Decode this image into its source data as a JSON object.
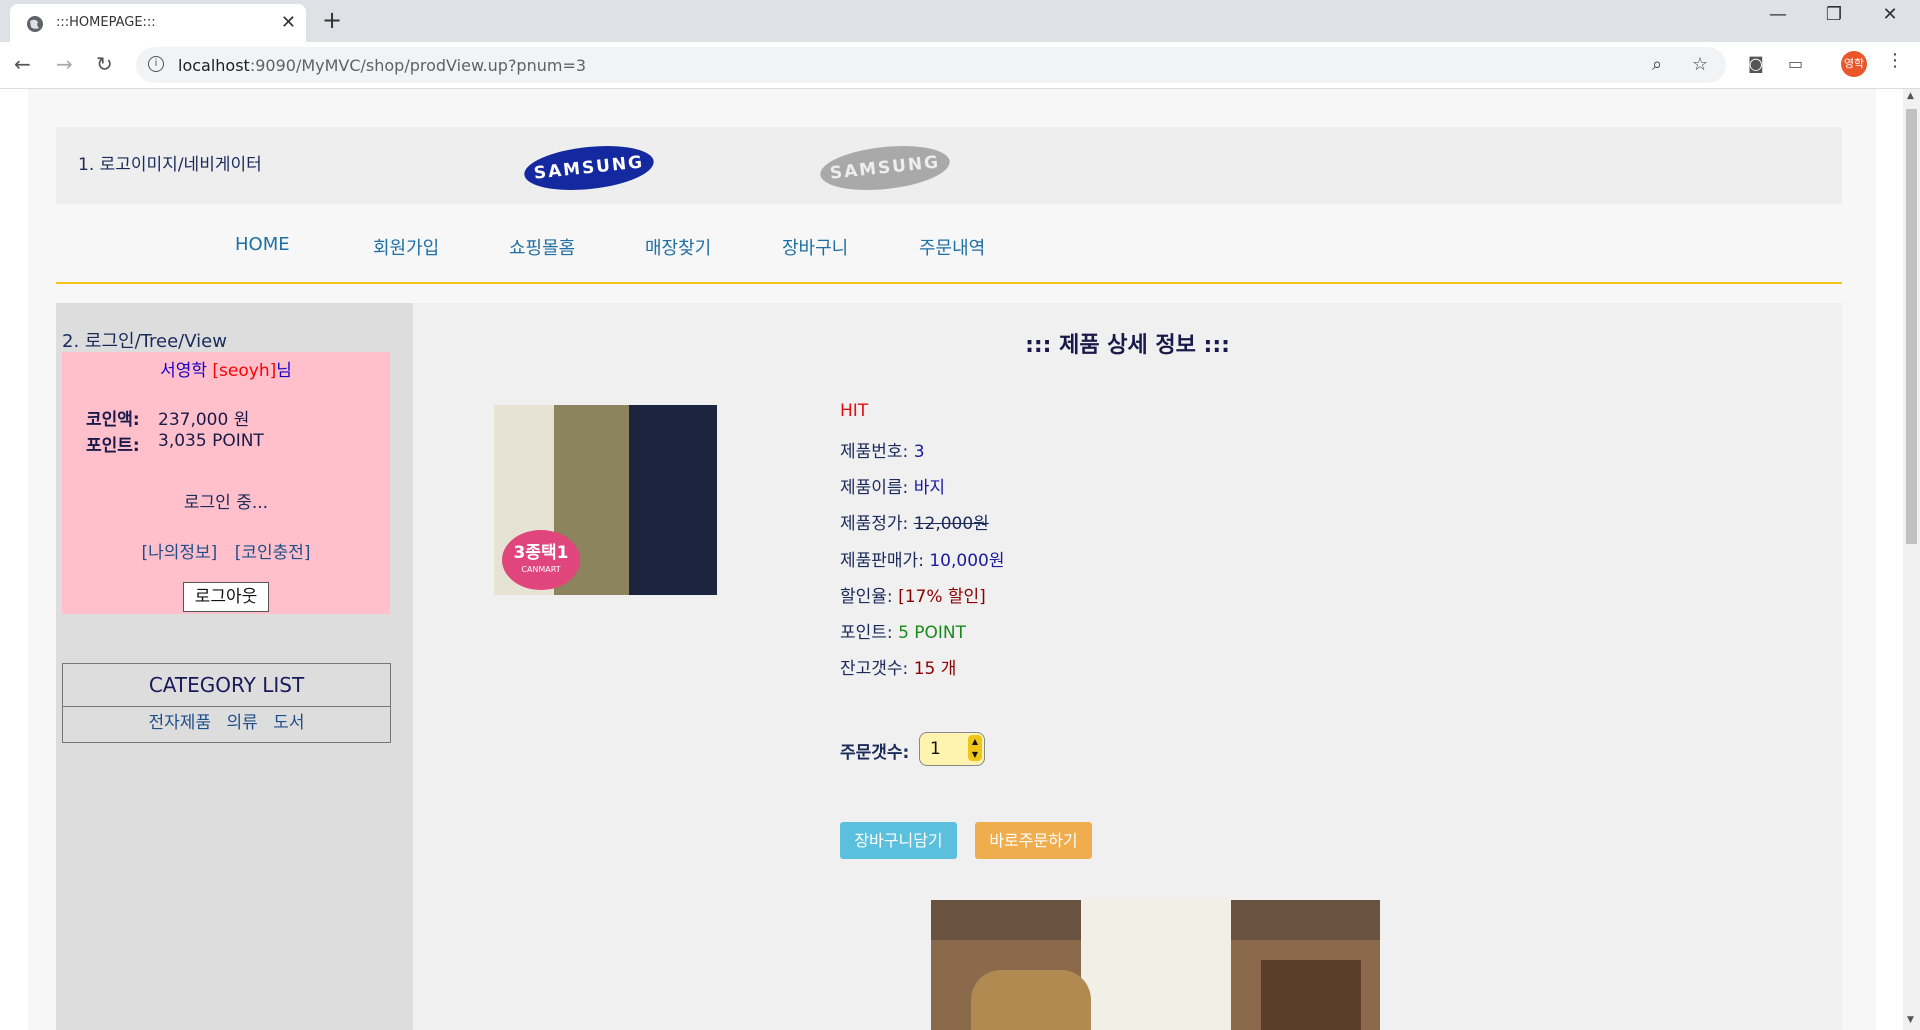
{
  "browser": {
    "tab_title": ":::HOMEPAGE:::",
    "url_host": "localhost",
    "url_rest": ":9090/MyMVC/shop/prodView.up?pnum=3",
    "profile_initials": "영학"
  },
  "header": {
    "label": "1. 로고이미지/네비게이터",
    "logo_text": "SAMSUNG"
  },
  "nav": {
    "items": [
      "HOME",
      "회원가입",
      "쇼핑몰홈",
      "매장찾기",
      "장바구니",
      "주문내역"
    ]
  },
  "sidebar": {
    "label": "2. 로그인/Tree/View",
    "user_name": "서영학",
    "user_id": "[seoyh]",
    "user_suffix": "님",
    "coin_label": "코인액:",
    "coin_value": "237,000 원",
    "point_label": "포인트:",
    "point_value": "3,035 POINT",
    "status": "로그인 중...",
    "link_myinfo": "[나의정보]",
    "link_charge": "[코인충전]",
    "logout": "로그아웃",
    "category_title": "CATEGORY LIST",
    "categories": [
      "전자제품",
      "의류",
      "도서"
    ]
  },
  "product": {
    "title": "::: 제품 상세 정보 :::",
    "badge": "HIT",
    "image_badge": "3종택1",
    "image_badge_sub": "CANMART",
    "num_label": "제품번호: ",
    "num_value": "3",
    "name_label": "제품이름: ",
    "name_value": "바지",
    "price_label": "제품정가: ",
    "price_value": "12,000원",
    "sale_label": "제품판매가: ",
    "sale_value": "10,000원",
    "discount_label": "할인율: ",
    "discount_value": "[17% 할인]",
    "point_label": "포인트: ",
    "point_value": "5 POINT",
    "stock_label": "잔고갯수: ",
    "stock_value": "15 개",
    "qty_label": "주문갯수:",
    "qty_value": "1",
    "cart_button": "장바구니담기",
    "order_button": "바로주문하기"
  },
  "colors": {
    "nav_underline": "#f0c419",
    "login_box": "#ffc0cb",
    "btn_cart": "#5bc0de",
    "btn_order": "#f0ad4e"
  }
}
